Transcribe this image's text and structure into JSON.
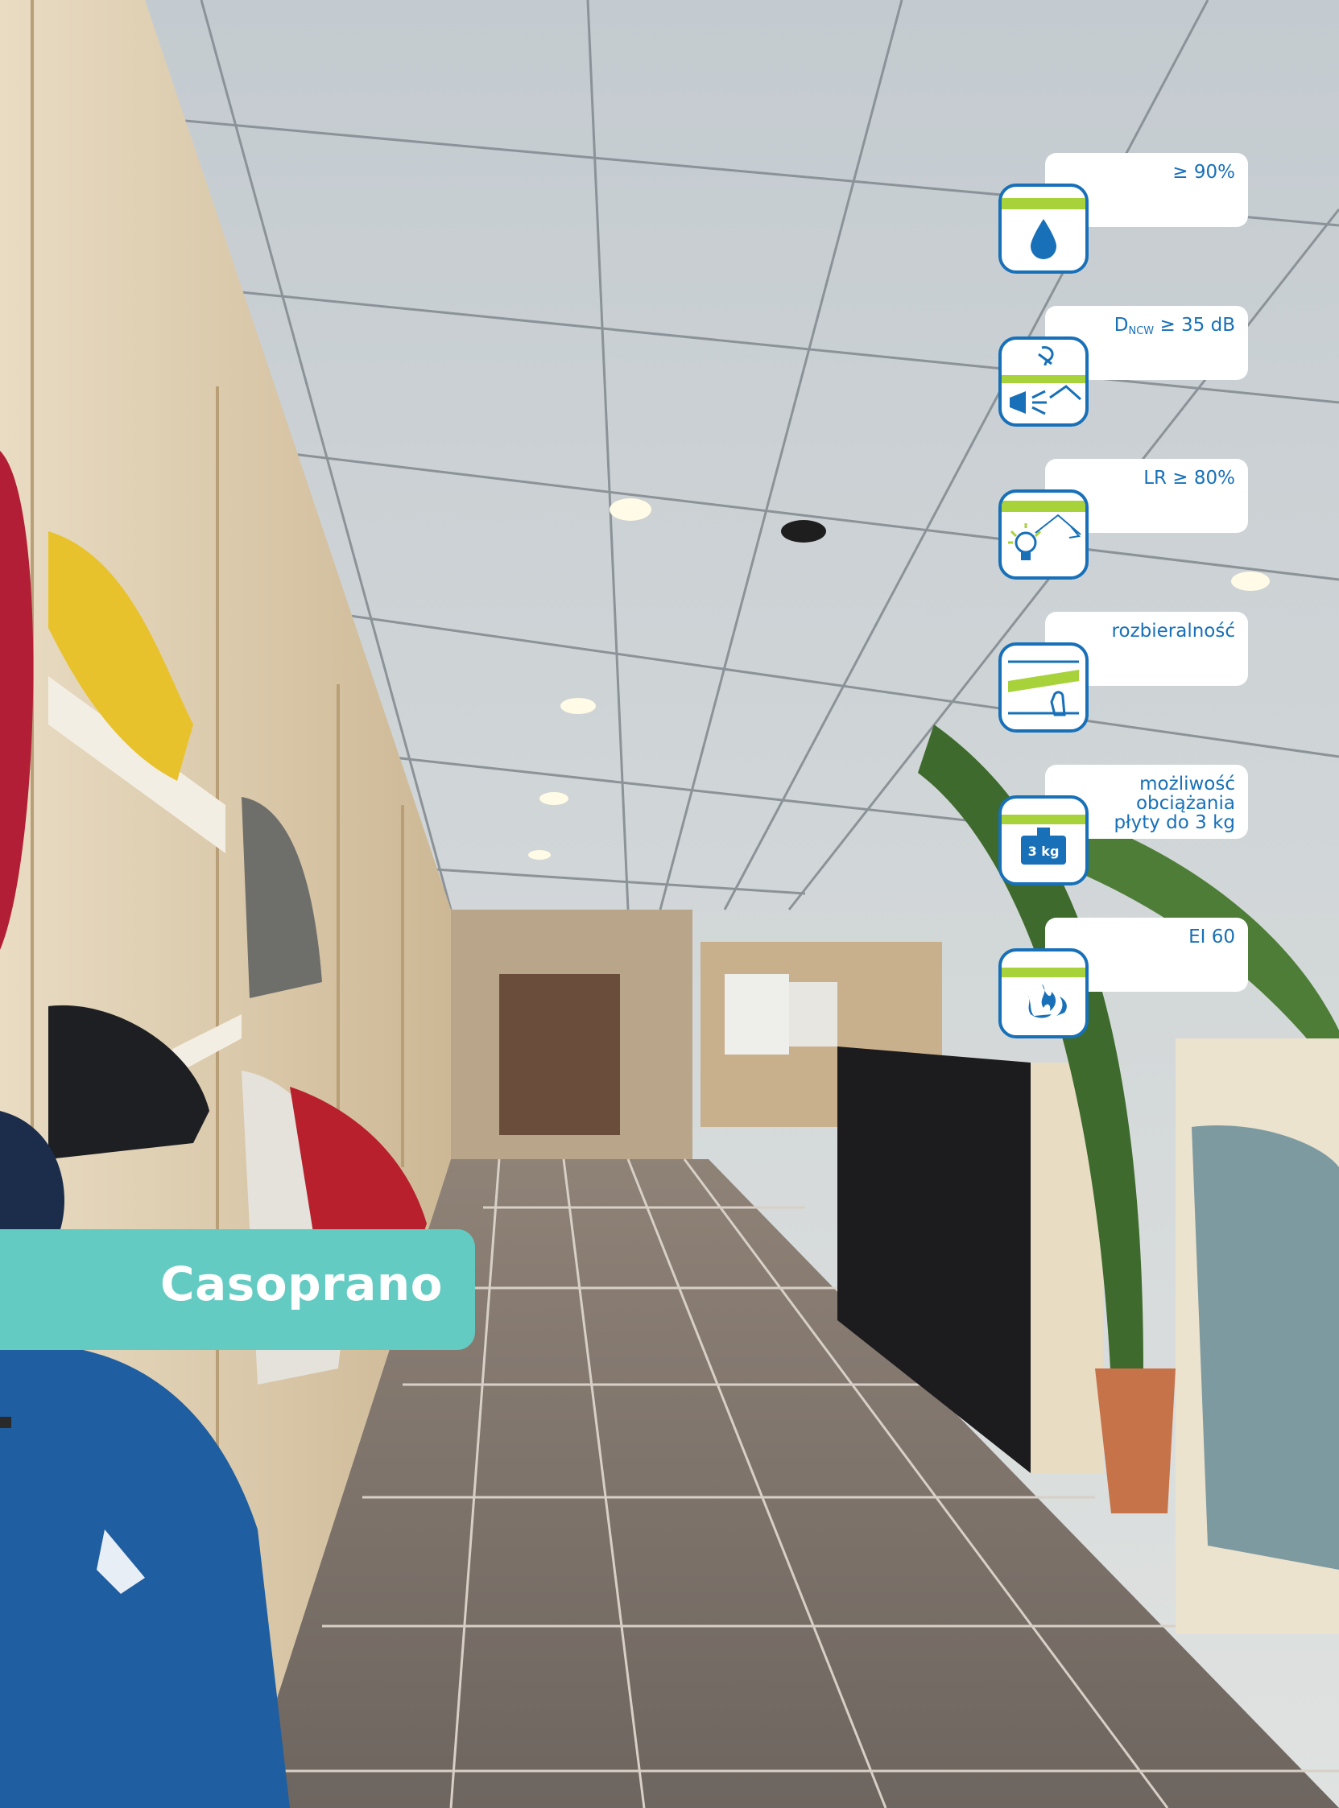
{
  "banner": {
    "title": "Casoprano"
  },
  "features": [
    {
      "icon": "water-drop-icon",
      "text": "≥ 90%"
    },
    {
      "icon": "sound-insulation-icon",
      "text_prefix": "D",
      "text_sub": "NCW",
      "text_suffix": " ≥ 35 dB"
    },
    {
      "icon": "light-reflection-icon",
      "text": "LR ≥ 80%"
    },
    {
      "icon": "demountable-panel-icon",
      "text": "rozbieralność"
    },
    {
      "icon": "weight-load-icon",
      "text": "możliwość\nobciążania\npłyty do 3 kg",
      "icon_label": "3 kg"
    },
    {
      "icon": "fire-resistance-icon",
      "text": "EI 60"
    }
  ],
  "colors": {
    "brand_blue": "#1770b8",
    "accent_green": "#a8d23a",
    "banner_teal": "#64cbc3"
  }
}
